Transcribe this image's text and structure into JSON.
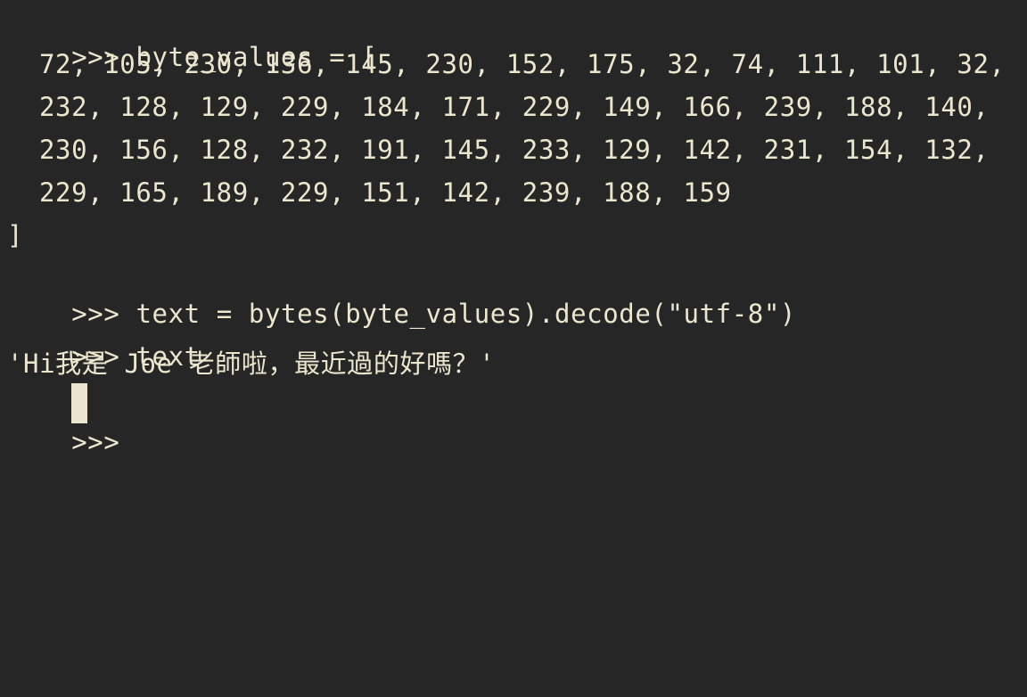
{
  "terminal": {
    "prompt": ">>> ",
    "lines": [
      {
        "type": "input",
        "text": "byte_values = ["
      },
      {
        "type": "cont",
        "text": "72, 105, 230, 136, 145, 230, 152, 175, 32, 74, 111, 101, 32,"
      },
      {
        "type": "cont",
        "text": "232, 128, 129, 229, 184, 171, 229, 149, 166, 239, 188, 140,"
      },
      {
        "type": "cont",
        "text": "230, 156, 128, 232, 191, 145, 233, 129, 142, 231, 154, 132,"
      },
      {
        "type": "cont",
        "text": "229, 165, 189, 229, 151, 142, 239, 188, 159"
      },
      {
        "type": "output",
        "text": "]"
      },
      {
        "type": "input",
        "text": "text = bytes(byte_values).decode(\"utf-8\")"
      },
      {
        "type": "input",
        "text": "text"
      },
      {
        "type": "output",
        "text": "'Hi我是 Joe 老師啦，最近過的好嗎？'"
      }
    ],
    "last_prompt": ">>>"
  },
  "colors": {
    "background": "#262626",
    "foreground": "#ece6cf",
    "cursor": "#ece6cf"
  }
}
